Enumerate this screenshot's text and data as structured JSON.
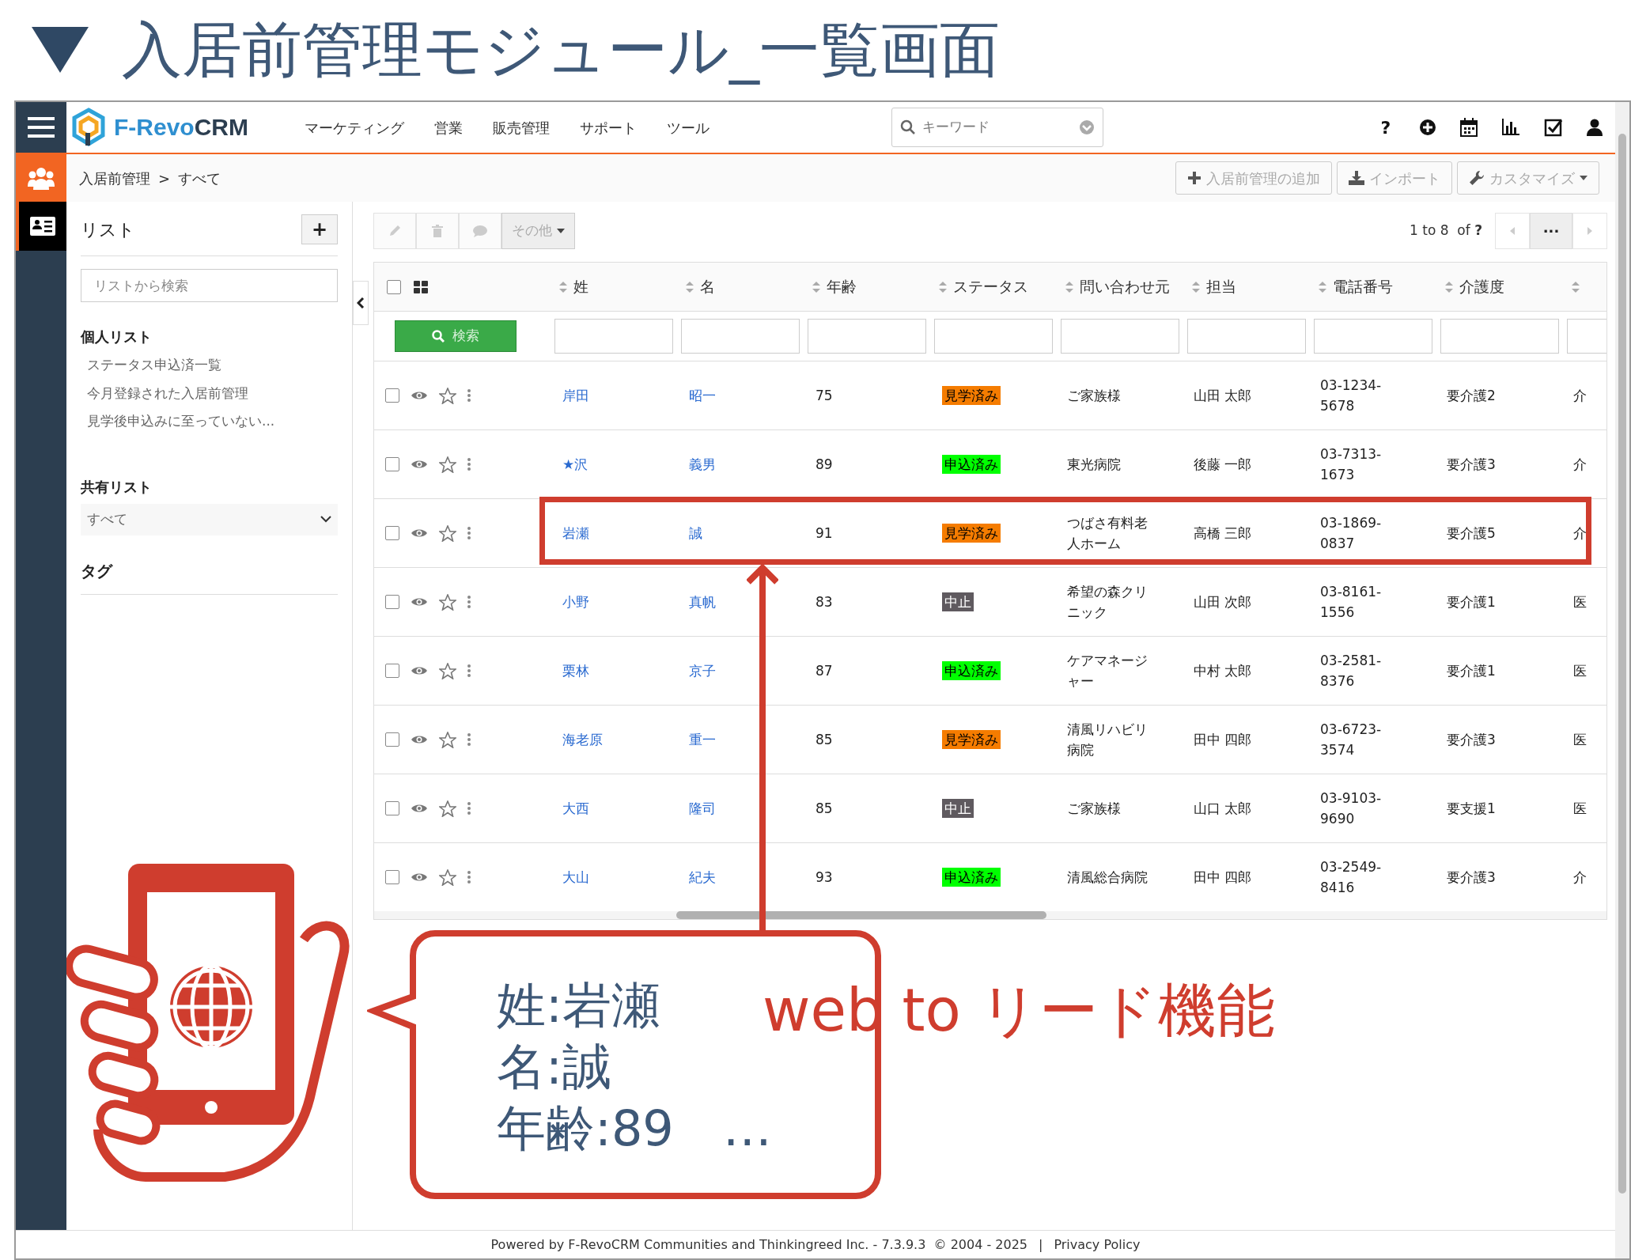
{
  "slide": {
    "title": "入居前管理モジュール_一覧画面"
  },
  "app": {
    "logo_parts": [
      "F-Revo",
      "CRM"
    ],
    "menu": [
      "マーケティング",
      "営業",
      "販売管理",
      "サポート",
      "ツール"
    ],
    "search": {
      "placeholder": "キーワード"
    },
    "help": "?",
    "breadcrumb": {
      "items": [
        "入居前管理",
        "すべて"
      ],
      "separator": ">"
    },
    "actions": [
      {
        "label": "入居前管理の追加",
        "kind": "add"
      },
      {
        "label": "インポート",
        "kind": "import"
      },
      {
        "label": "カスタマイズ",
        "kind": "customize"
      }
    ],
    "list_panel": {
      "title": "リスト",
      "add": "+",
      "search": {
        "placeholder": "リストから検索"
      },
      "personal": {
        "heading": "個人リスト",
        "items": [
          "ステータス申込済一覧",
          "今月登録された入居前管理",
          "見学後申込みに至っていない..."
        ]
      },
      "shared": {
        "heading": "共有リスト",
        "value": "すべて"
      },
      "tags": {
        "heading": "タグ"
      }
    },
    "toolbar": {
      "more": "その他",
      "pagination": "1 to 8  of **?**",
      "menu": "···"
    },
    "table": {
      "header_checked": false,
      "columns": [
        "姓",
        "名",
        "年齢",
        "ステータス",
        "問い合わせ元",
        "担当",
        "電話番号",
        "介護度"
      ],
      "search_button": "検索",
      "rows": [
        {
          "checked": false,
          "last_name": "岸田",
          "first_name": "昭一",
          "age": "75",
          "status": {
            "label": "見学済み",
            "color": "#f57c00"
          },
          "source": "ご家族様",
          "owner": "山田 太郎",
          "phone": "03-1234-5678",
          "care_level": "要介護2",
          "column_10": "介"
        },
        {
          "checked": false,
          "last_name": "★沢",
          "first_name": "義男",
          "age": "89",
          "status": {
            "label": "申込済み",
            "color": "#00ff00"
          },
          "source": "東光病院",
          "owner": "後藤 一郎",
          "phone": "03-7313-1673",
          "care_level": "要介護3",
          "column_10": "介"
        },
        {
          "checked": false,
          "last_name": "岩瀬",
          "first_name": "誠",
          "age": "91",
          "status": {
            "label": "見学済み",
            "color": "#f57c00"
          },
          "source": "つばさ有料老人ホーム",
          "owner": "高橋 三郎",
          "phone": "03-1869-0837",
          "care_level": "要介護5",
          "column_10": "介"
        },
        {
          "checked": false,
          "last_name": "小野",
          "first_name": "真帆",
          "age": "83",
          "status": {
            "label": "中止",
            "color": "#5f5a5f"
          },
          "source": "希望の森クリニック",
          "owner": "山田 次郎",
          "phone": "03-8161-1556",
          "care_level": "要介護1",
          "column_10": "医"
        },
        {
          "checked": false,
          "last_name": "栗林",
          "first_name": "京子",
          "age": "87",
          "status": {
            "label": "申込済み",
            "color": "#00ff00"
          },
          "source": "ケアマネージャー",
          "owner": "中村 太郎",
          "phone": "03-2581-8376",
          "care_level": "要介護1",
          "column_10": "医"
        },
        {
          "checked": false,
          "last_name": "海老原",
          "first_name": "重一",
          "age": "85",
          "status": {
            "label": "見学済み",
            "color": "#f57c00"
          },
          "source": "清風リハビリ病院",
          "owner": "田中 四郎",
          "phone": "03-6723-3574",
          "care_level": "要介護3",
          "column_10": "医"
        },
        {
          "checked": false,
          "last_name": "大西",
          "first_name": "隆司",
          "age": "85",
          "status": {
            "label": "中止",
            "color": "#5f5a5f"
          },
          "source": "ご家族様",
          "owner": "山口 太郎",
          "phone": "03-9103-9690",
          "care_level": "要支援1",
          "column_10": "医"
        },
        {
          "checked": false,
          "last_name": "大山",
          "first_name": "紀夫",
          "age": "93",
          "status": {
            "label": "申込済み",
            "color": "#00ff00"
          },
          "source": "清風総合病院",
          "owner": "田中 四郎",
          "phone": "03-2549-8416",
          "care_level": "要介護3",
          "column_10": "介"
        }
      ]
    },
    "footer": {
      "text": "Powered by F-RevoCRM Communities and Thinkingreed Inc. - 7.3.9.3  © 2004 - 2025",
      "separator": "|",
      "link": "Privacy Policy"
    }
  },
  "annotation": {
    "callout_lines": [
      "姓:岩瀬",
      "名:誠",
      "年齢:89　…"
    ],
    "caption": "web to リード機能"
  }
}
